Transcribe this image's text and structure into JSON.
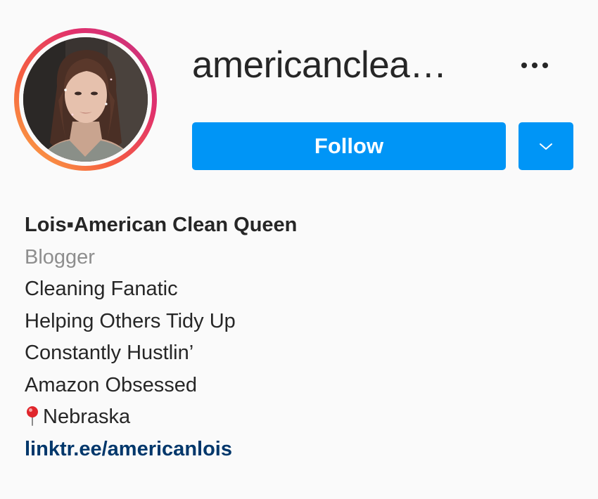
{
  "profile": {
    "username": "americanclea…",
    "follow_label": "Follow",
    "full_name": "Lois▪American Clean Queen",
    "category": "Blogger",
    "bio_lines": [
      "Cleaning Fanatic",
      "Helping Others Tidy Up",
      "Constantly Hustlin’",
      "Amazon Obsessed"
    ],
    "location": "Nebraska",
    "link": "linktr.ee/americanlois"
  },
  "icons": {
    "more": "more-options-icon",
    "dropdown": "chevron-down-icon",
    "location": "round-pushpin-icon"
  },
  "colors": {
    "accent": "#0095f6",
    "link": "#00376b",
    "secondary_text": "#8e8e8e",
    "primary_text": "#262626",
    "background": "#fafafa"
  }
}
